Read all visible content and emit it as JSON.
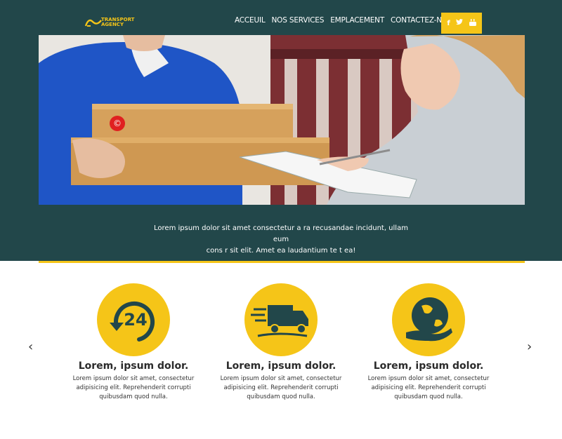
{
  "brand": {
    "name_line1": "TRANSPORT",
    "name_line2": "AGENCY",
    "accent": "#f5c518",
    "dark": "#22474a"
  },
  "nav": {
    "items": [
      {
        "label": "ACCEUIL"
      },
      {
        "label": "NOS SERVICES"
      },
      {
        "label": "EMPLACEMENT"
      },
      {
        "label": "CONTACTEZ-NOUS"
      }
    ],
    "social": {
      "facebook": "f",
      "twitter": "t",
      "youtube": "▶"
    }
  },
  "hero": {
    "tagline_line1": "Lorem ipsum dolor sit amet consectetur a ra recusandae incidunt, ullam eum",
    "tagline_line2": "cons r sit elit. Amet ea laudantium te t ea!"
  },
  "features": [
    {
      "icon": "24-hour-icon",
      "title": "Lorem, ipsum dolor.",
      "text": "Lorem ipsum dolor sit amet, consectetur adipisicing elit. Reprehenderit corrupti quibusdam quod nulla."
    },
    {
      "icon": "delivery-truck-icon",
      "title": "Lorem, ipsum dolor.",
      "text": "Lorem ipsum dolor sit amet, consectetur adipisicing elit. Reprehenderit corrupti quibusdam quod nulla."
    },
    {
      "icon": "globe-hand-icon",
      "title": "Lorem, ipsum dolor.",
      "text": "Lorem ipsum dolor sit amet, consectetur adipisicing elit. Reprehenderit corrupti quibusdam quod nulla."
    }
  ],
  "carousel": {
    "prev": "‹",
    "next": "›"
  }
}
